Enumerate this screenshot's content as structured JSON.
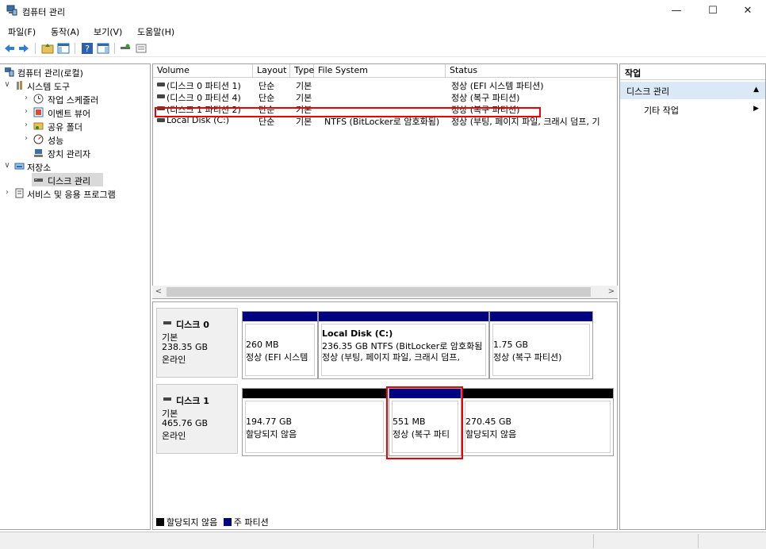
{
  "window": {
    "title": "컴퓨터 관리",
    "min": "—",
    "max": "☐",
    "close": "✕"
  },
  "menu": [
    "파일(F)",
    "동작(A)",
    "보기(V)",
    "도움말(H)"
  ],
  "tree": [
    {
      "label": "컴퓨터 관리(로컬)",
      "arrow": ""
    },
    {
      "label": "시스템 도구",
      "arrow": "∨"
    },
    {
      "label": "작업 스케줄러",
      "arrow": "›"
    },
    {
      "label": "이벤트 뷰어",
      "arrow": "›"
    },
    {
      "label": "공유 폴더",
      "arrow": "›"
    },
    {
      "label": "성능",
      "arrow": "›"
    },
    {
      "label": "장치 관리자",
      "arrow": ""
    },
    {
      "label": "저장소",
      "arrow": "∨"
    },
    {
      "label": "디스크 관리",
      "arrow": ""
    },
    {
      "label": "서비스 및 응용 프로그램",
      "arrow": "›"
    }
  ],
  "list": {
    "columns": [
      "Volume",
      "Layout",
      "Type",
      "File System",
      "Status"
    ],
    "rows": [
      {
        "volume": "(디스크 0 파티션 1)",
        "layout": "단순",
        "type": "기본",
        "fs": "",
        "status": "정상 (EFI 시스템 파티션)"
      },
      {
        "volume": "(디스크 0 파티션 4)",
        "layout": "단순",
        "type": "기본",
        "fs": "",
        "status": "정상 (복구 파티션)"
      },
      {
        "volume": "(디스크 1 파티션 2)",
        "layout": "단순",
        "type": "기본",
        "fs": "",
        "status": "정상 (복구 파티션)"
      },
      {
        "volume": "Local Disk (C:)",
        "layout": "단순",
        "type": "기본",
        "fs": "NTFS (BitLocker로 암호화됨)",
        "status": "정상 (부팅, 페이지 파일, 크래시 덤프, 기"
      }
    ]
  },
  "scroll": {
    "left": "<",
    "right": ">"
  },
  "disks": [
    {
      "name": "디스크 0",
      "type": "기본",
      "size": "238.35 GB",
      "state": "온라인",
      "parts": [
        {
          "title": "",
          "line1": "260 MB",
          "line2": "정상 (EFI 시스템",
          "color": "#000080"
        },
        {
          "title": "Local Disk  (C:)",
          "line1": "236.35 GB NTFS (BitLocker로 암호화됨",
          "line2": "정상 (부팅, 페이지 파일, 크래시 덤프,",
          "color": "#000080"
        },
        {
          "title": "",
          "line1": "1.75 GB",
          "line2": "정상 (복구 파티션)",
          "color": "#000080"
        }
      ]
    },
    {
      "name": "디스크 1",
      "type": "기본",
      "size": "465.76 GB",
      "state": "온라인",
      "parts": [
        {
          "title": "",
          "line1": "194.77 GB",
          "line2": "할당되지 않음",
          "color": "#000000"
        },
        {
          "title": "",
          "line1": "551 MB",
          "line2": "정상 (복구 파티",
          "color": "#000080"
        },
        {
          "title": "",
          "line1": "270.45 GB",
          "line2": "할당되지 않음",
          "color": "#000000"
        }
      ]
    }
  ],
  "legend": [
    {
      "label": "할당되지 않음",
      "color": "#000000"
    },
    {
      "label": "주 파티션",
      "color": "#000080"
    }
  ],
  "actions": {
    "header": "작업",
    "section": "디스크 관리",
    "more": "기타 작업",
    "up": "▲",
    "right": "▶"
  }
}
